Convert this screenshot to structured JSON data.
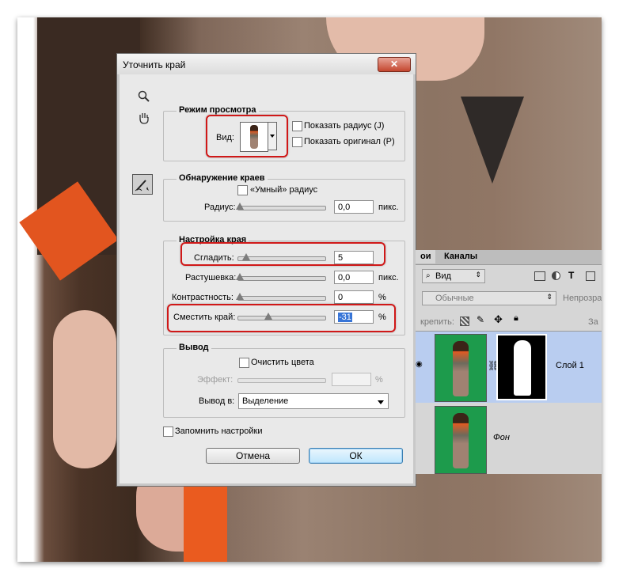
{
  "dialog": {
    "title": "Уточнить край",
    "close_label": "✕",
    "view_mode": {
      "legend": "Режим просмотра",
      "view_label": "Вид:",
      "show_radius": "Показать радиус (J)",
      "show_original": "Показать оригинал (P)"
    },
    "edge_detection": {
      "legend": "Обнаружение краев",
      "smart_radius": "«Умный» радиус",
      "radius_label": "Радиус:",
      "radius_value": "0,0",
      "radius_unit": "пикс."
    },
    "adjust_edge": {
      "legend": "Настройка края",
      "smooth_label": "Сгладить:",
      "smooth_value": "5",
      "feather_label": "Растушевка:",
      "feather_value": "0,0",
      "feather_unit": "пикс.",
      "contrast_label": "Контрастность:",
      "contrast_value": "0",
      "contrast_unit": "%",
      "shift_label": "Сместить край:",
      "shift_value": "-31",
      "shift_unit": "%"
    },
    "output": {
      "legend": "Вывод",
      "decontaminate": "Очистить цвета",
      "amount_label": "Эффект:",
      "amount_unit": "%",
      "output_to_label": "Вывод в:",
      "output_to_value": "Выделение"
    },
    "remember": "Запомнить настройки",
    "cancel": "Отмена",
    "ok": "ОК"
  },
  "layers": {
    "tab_layers": "ои",
    "tab_channels": "Каналы",
    "filter_value": "Вид",
    "blend_mode": "Обычные",
    "opacity_label": "Непрозрач",
    "lock_label": "крепить:",
    "fill_label": "За",
    "layer1_name": "Слой 1",
    "background_name": "Фон"
  },
  "colors": {
    "accent_red": "#d01818",
    "green_backdrop": "#1d9b4c",
    "selected_layer": "#b9cdf0"
  }
}
